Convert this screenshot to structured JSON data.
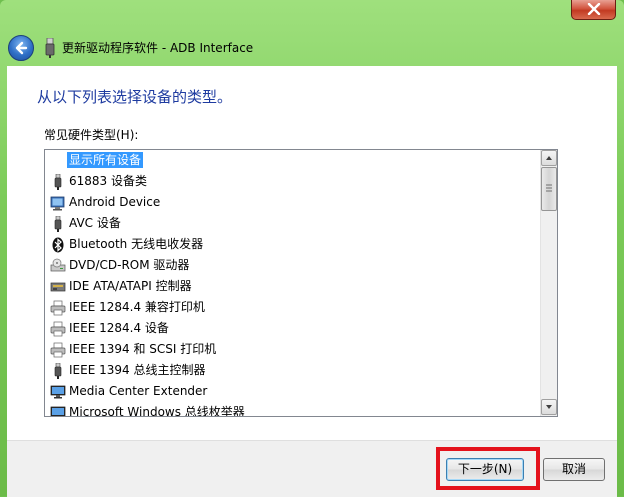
{
  "window": {
    "title": "更新驱动程序软件 - ADB Interface",
    "close_tooltip": "关闭"
  },
  "content": {
    "instruction": "从以下列表选择设备的类型。",
    "list_label": "常见硬件类型(H):",
    "items": [
      {
        "label": "显示所有设备",
        "icon": "none",
        "selected": true
      },
      {
        "label": "61883 设备类",
        "icon": "usb-plug-icon"
      },
      {
        "label": "Android Device",
        "icon": "android-device-icon"
      },
      {
        "label": "AVC 设备",
        "icon": "usb-plug-icon"
      },
      {
        "label": "Bluetooth 无线电收发器",
        "icon": "bluetooth-icon"
      },
      {
        "label": "DVD/CD-ROM 驱动器",
        "icon": "dvd-drive-icon"
      },
      {
        "label": "IDE ATA/ATAPI 控制器",
        "icon": "ide-controller-icon"
      },
      {
        "label": "IEEE 1284.4 兼容打印机",
        "icon": "printer-icon"
      },
      {
        "label": "IEEE 1284.4 设备",
        "icon": "printer-icon"
      },
      {
        "label": "IEEE 1394 和 SCSI 打印机",
        "icon": "printer-icon"
      },
      {
        "label": "IEEE 1394 总线主控制器",
        "icon": "usb-plug-icon"
      },
      {
        "label": "Media Center Extender",
        "icon": "monitor-icon"
      },
      {
        "label": "Microsoft Windows 总线枚举器",
        "icon": "monitor-icon"
      }
    ]
  },
  "footer": {
    "next_label": "下一步(N)",
    "cancel_label": "取消"
  },
  "colors": {
    "accent": "#3399ff",
    "instruction_text": "#1e3ba0",
    "highlight_box": "#e4121c",
    "frame": "#7ccb59"
  }
}
